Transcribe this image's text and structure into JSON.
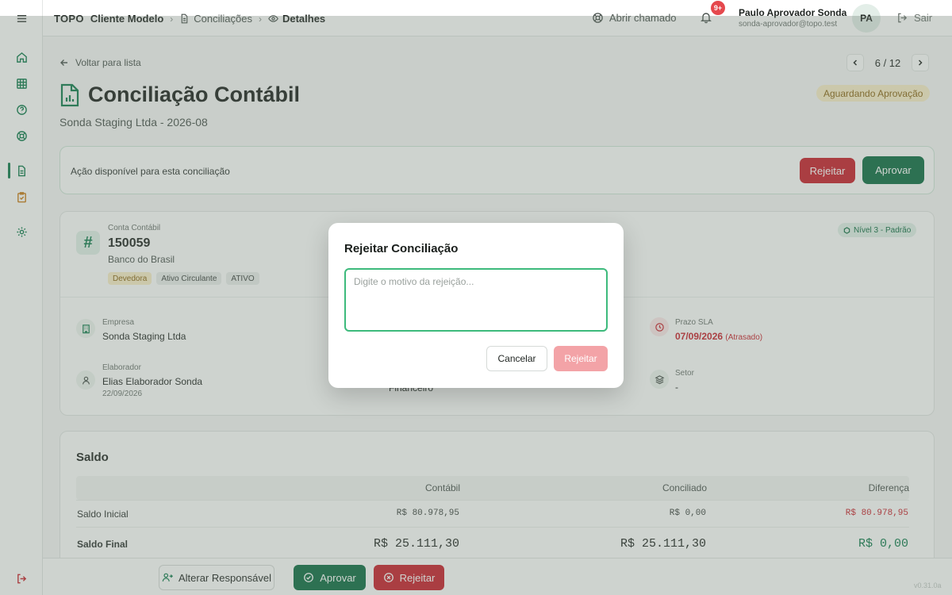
{
  "header": {
    "brand": "TOPO",
    "client": "Cliente Modelo",
    "crumb_conciliacoes": "Conciliações",
    "crumb_detalhes": "Detalhes",
    "open_ticket": "Abrir chamado",
    "notifications_badge": "9+",
    "user_name": "Paulo Aprovador Sonda",
    "user_email": "sonda-aprovador@topo.test",
    "avatar_initials": "PA",
    "logout": "Sair"
  },
  "sidebar": {
    "items": [
      "home-icon",
      "grid-icon",
      "help-icon",
      "support-icon",
      "document-icon",
      "clipboard-icon",
      "settings-icon"
    ],
    "active": "document-icon",
    "logout_icon": "logout-icon"
  },
  "page": {
    "back": "Voltar para lista",
    "pager": "6 / 12",
    "title": "Conciliação Contábil",
    "subtitle": "Sonda Staging Ltda - 2026-08",
    "status": "Aguardando Aprovação"
  },
  "action_card": {
    "text": "Ação disponível para esta conciliação",
    "reject": "Rejeitar",
    "approve": "Aprovar"
  },
  "account": {
    "label": "Conta Contábil",
    "number": "150059",
    "name": "Banco do Brasil",
    "tags": [
      "Devedora",
      "Ativo Circulante",
      "ATIVO"
    ],
    "level": "Nível 3 - Padrão"
  },
  "fields": {
    "empresa_label": "Empresa",
    "empresa_value": "Sonda Staging Ltda",
    "prazo_label": "Prazo SLA",
    "prazo_value": "07/09/2026",
    "prazo_note": "(Atrasado)",
    "elaborador_label": "Elaborador",
    "elaborador_value": "Elias Elaborador Sonda",
    "elaborador_date": "22/09/2026",
    "area_value": "Financeiro",
    "setor_label": "Setor",
    "setor_value": "-"
  },
  "saldo": {
    "title": "Saldo",
    "columns": [
      "Contábil",
      "Conciliado",
      "Diferença"
    ],
    "rows": [
      {
        "label": "Saldo Inicial",
        "contabil": "R$ 80.978,95",
        "conciliado": "R$ 0,00",
        "diferenca": "R$ 80.978,95"
      },
      {
        "label": "Saldo Final",
        "contabil": "R$ 25.111,30",
        "conciliado": "R$ 25.111,30",
        "diferenca": "R$ 0,00"
      }
    ]
  },
  "bottom_bar": {
    "alter": "Alterar Responsável",
    "approve": "Aprovar",
    "reject": "Rejeitar",
    "version": "v0.31.0a"
  },
  "modal": {
    "title": "Rejeitar Conciliação",
    "placeholder": "Digite o motivo da rejeição...",
    "value": "",
    "cancel": "Cancelar",
    "reject": "Rejeitar"
  },
  "colors": {
    "brand_green": "#0b6b42",
    "danger": "#c81e2a",
    "warning_bg": "#fbefc8",
    "focus_ring": "#3dba7c"
  }
}
